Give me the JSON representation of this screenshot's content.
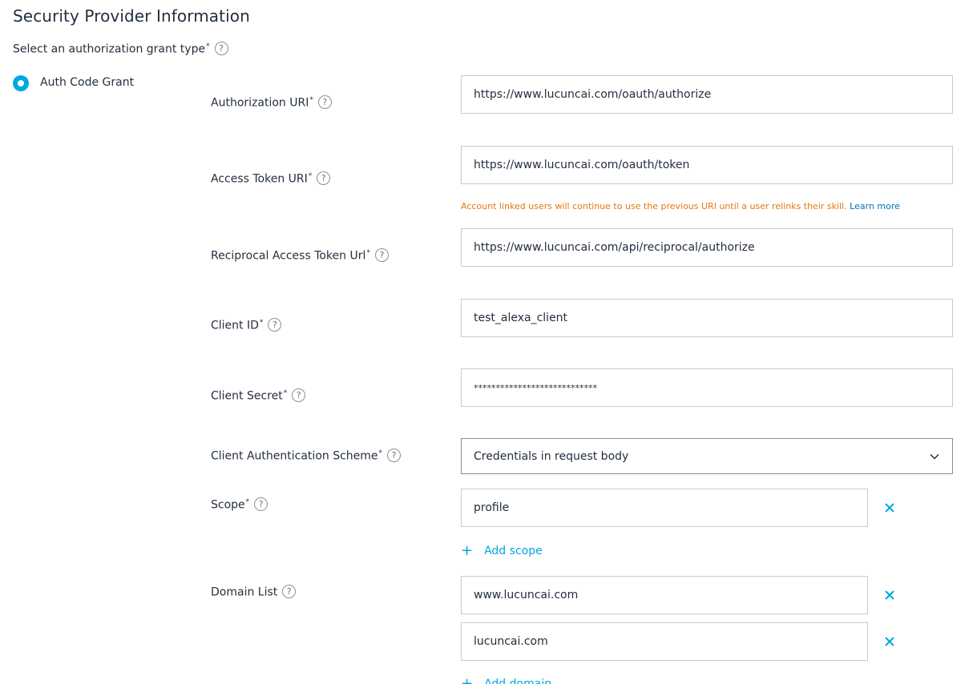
{
  "section": {
    "title": "Security Provider Information",
    "grant_type_label": "Select an authorization grant type",
    "required_mark": "*",
    "help_glyph": "?"
  },
  "grant_options": [
    {
      "label": "Auth Code Grant",
      "selected": true
    }
  ],
  "fields": {
    "authorization_uri": {
      "label": "Authorization URI",
      "value": "https://www.lucuncai.com/oauth/authorize"
    },
    "access_token_uri": {
      "label": "Access Token URI",
      "value": "https://www.lucuncai.com/oauth/token"
    },
    "reciprocal_access_token_url": {
      "label": "Reciprocal Access Token Url",
      "value": "https://www.lucuncai.com/api/reciprocal/authorize"
    },
    "client_id": {
      "label": "Client ID",
      "value": "test_alexa_client"
    },
    "client_secret": {
      "label": "Client Secret",
      "value": "****************************"
    },
    "client_auth_scheme": {
      "label": "Client Authentication Scheme",
      "value": "Credentials in request body"
    },
    "scope": {
      "label": "Scope",
      "items": [
        "profile"
      ],
      "add_label": "Add scope"
    },
    "domain_list": {
      "label": "Domain List",
      "items": [
        "www.lucuncai.com",
        "lucuncai.com"
      ],
      "add_label": "Add domain"
    }
  },
  "warning": {
    "text": "Account linked users will continue to use the previous URI until a user relinks their skill.",
    "link": "Learn more"
  },
  "colors": {
    "accent": "#00a8e1",
    "warning": "#e47911",
    "link": "#0073bb",
    "text": "#232f3e",
    "border": "#c7cbcf"
  },
  "icons": {
    "help": "question-circle-icon",
    "remove": "close-x-icon",
    "add": "plus-icon",
    "dropdown": "chevron-down-icon"
  }
}
